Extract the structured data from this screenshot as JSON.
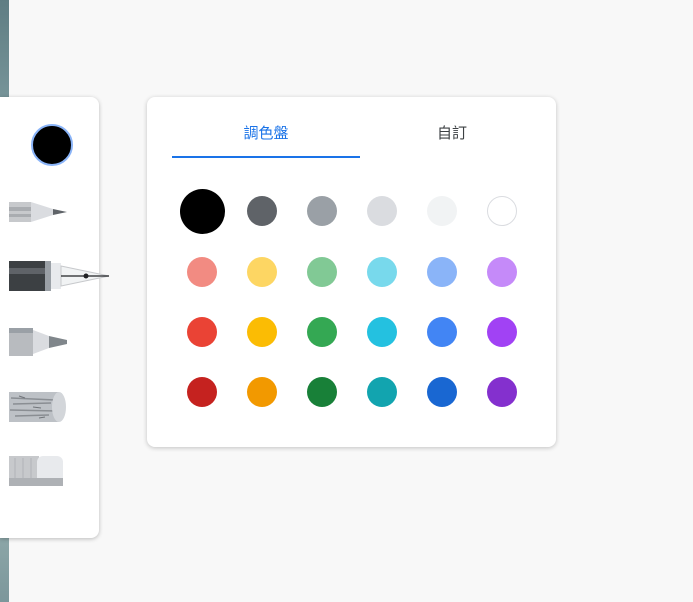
{
  "tabs": [
    {
      "label": "調色盤",
      "selected": true
    },
    {
      "label": "自訂",
      "selected": false
    }
  ],
  "current_color": "#000000",
  "tools": [
    "pencil",
    "fountain-pen",
    "marker",
    "chalk",
    "eraser"
  ],
  "palette_colors": [
    [
      "#000000",
      "#5f6368",
      "#9aa0a6",
      "#dadce0",
      "#f1f3f4",
      "#ffffff"
    ],
    [
      "#f28b82",
      "#fdd663",
      "#81c995",
      "#78d9ec",
      "#8ab4f8",
      "#c58af9"
    ],
    [
      "#ea4335",
      "#fbbc04",
      "#34a853",
      "#24c1e0",
      "#4285f4",
      "#a142f4"
    ],
    [
      "#c5221f",
      "#f29900",
      "#188038",
      "#12a4af",
      "#1967d2",
      "#8430ce"
    ]
  ],
  "selected_color": "#000000"
}
